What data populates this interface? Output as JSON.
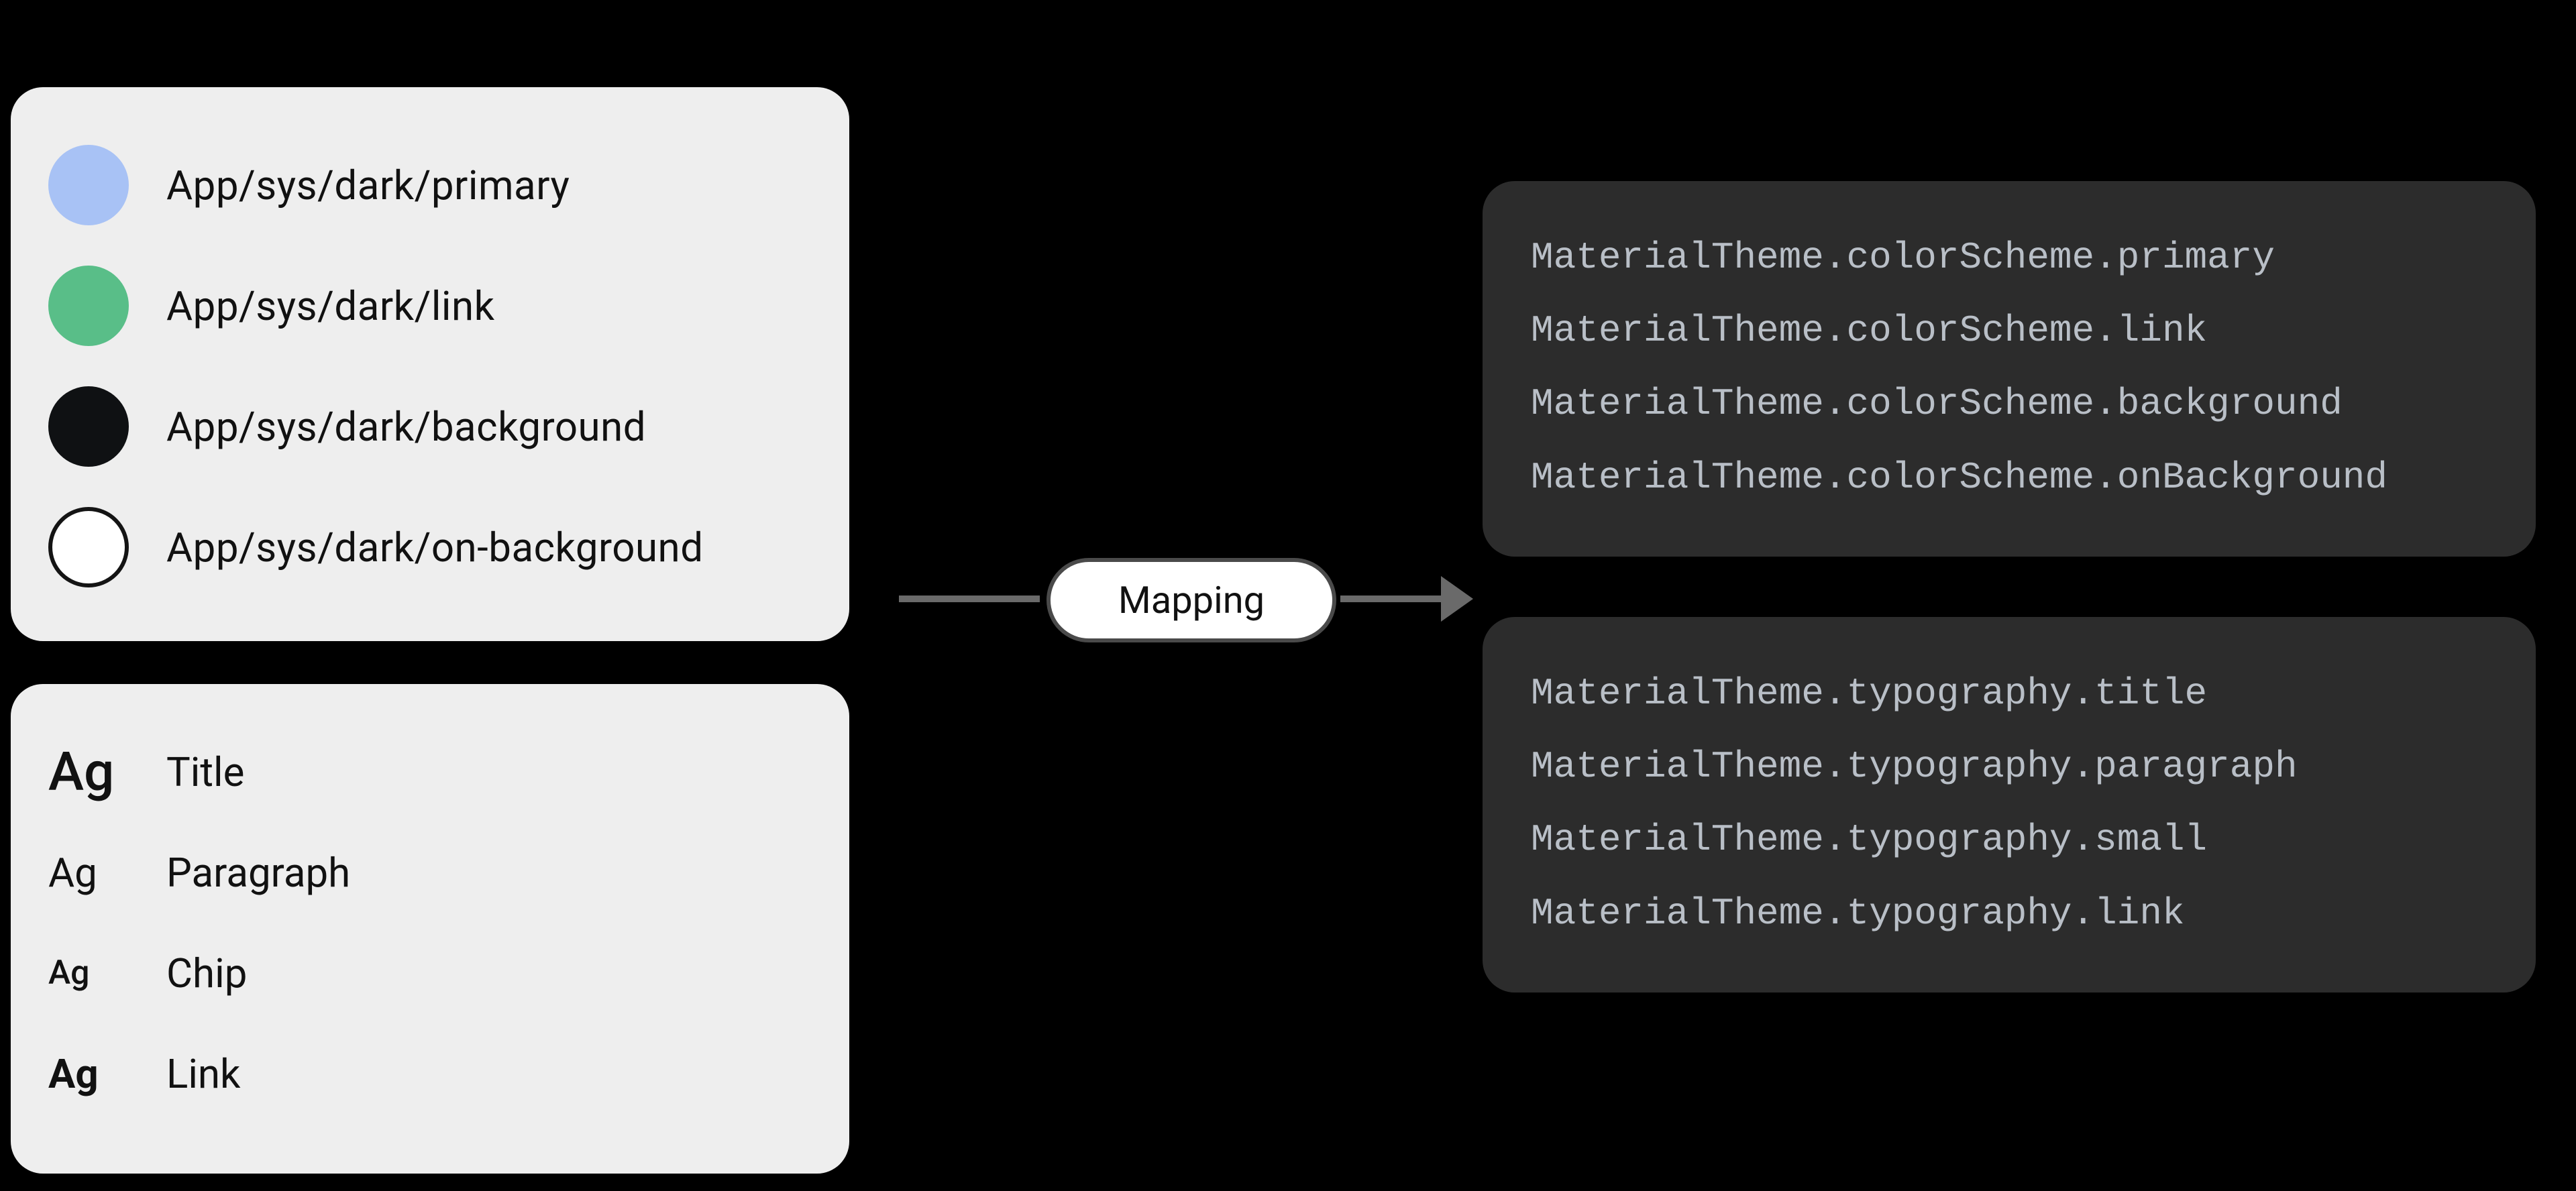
{
  "colors": {
    "items": [
      {
        "label": "App/sys/dark/primary",
        "hex": "#a8c2f5",
        "stroke": false
      },
      {
        "label": "App/sys/dark/link",
        "hex": "#59be88",
        "stroke": false
      },
      {
        "label": "App/sys/dark/background",
        "hex": "#0f1113",
        "stroke": false
      },
      {
        "label": "App/sys/dark/on-background",
        "hex": "#ffffff",
        "stroke": true
      }
    ]
  },
  "typography": {
    "glyph": "Ag",
    "items": [
      {
        "label": "Title",
        "variant": "title"
      },
      {
        "label": "Paragraph",
        "variant": "para"
      },
      {
        "label": "Chip",
        "variant": "chip"
      },
      {
        "label": "Link",
        "variant": "link"
      }
    ]
  },
  "mapping_label": "Mapping",
  "code_colors": [
    "MaterialTheme.colorScheme.primary",
    "MaterialTheme.colorScheme.link",
    "MaterialTheme.colorScheme.background",
    "MaterialTheme.colorScheme.onBackground"
  ],
  "code_typography": [
    "MaterialTheme.typography.title",
    "MaterialTheme.typography.paragraph",
    "MaterialTheme.typography.small",
    "MaterialTheme.typography.link"
  ]
}
